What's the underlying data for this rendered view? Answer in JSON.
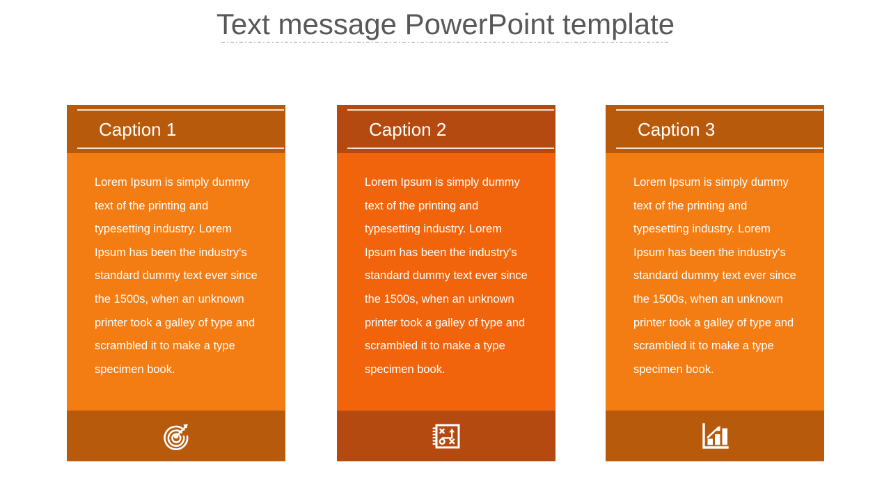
{
  "slide": {
    "title": "Text message PowerPoint template",
    "title_color": "#58585a",
    "background": "#ffffff",
    "divider_color": "#c9c9c9"
  },
  "cards": [
    {
      "caption": "Caption 1",
      "body": "Lorem Ipsum is simply dummy text of the printing and typesetting industry. Lorem Ipsum has been the industry's standard dummy text ever since the 1500s, when an unknown printer took a galley of type and scrambled it to make a type specimen book.",
      "icon": "target-arrow-icon",
      "header_color": "#b85a0c",
      "body_color": "#f37c13",
      "footer_color": "#b85a0c",
      "rule_color": "#f4e3d4",
      "text_color": "#ffffff"
    },
    {
      "caption": "Caption 2",
      "body": "Lorem Ipsum is simply dummy text of the printing and typesetting industry. Lorem Ipsum has been the industry's standard dummy text ever since the 1500s, when an unknown printer took a galley of type and scrambled it to make a type specimen book.",
      "icon": "strategy-playbook-icon",
      "header_color": "#b44a10",
      "body_color": "#f2640c",
      "footer_color": "#b44a10",
      "rule_color": "#f4e3d4",
      "text_color": "#ffffff"
    },
    {
      "caption": "Caption 3",
      "body": "Lorem Ipsum is simply dummy text of the printing and typesetting industry. Lorem Ipsum has been the industry's standard dummy text ever since the 1500s, when an unknown printer took a galley of type and scrambled it to make a type specimen book.",
      "icon": "bar-chart-growth-icon",
      "header_color": "#b85a0c",
      "body_color": "#f37c13",
      "footer_color": "#b85a0c",
      "rule_color": "#f4e3d4",
      "text_color": "#ffffff"
    }
  ]
}
